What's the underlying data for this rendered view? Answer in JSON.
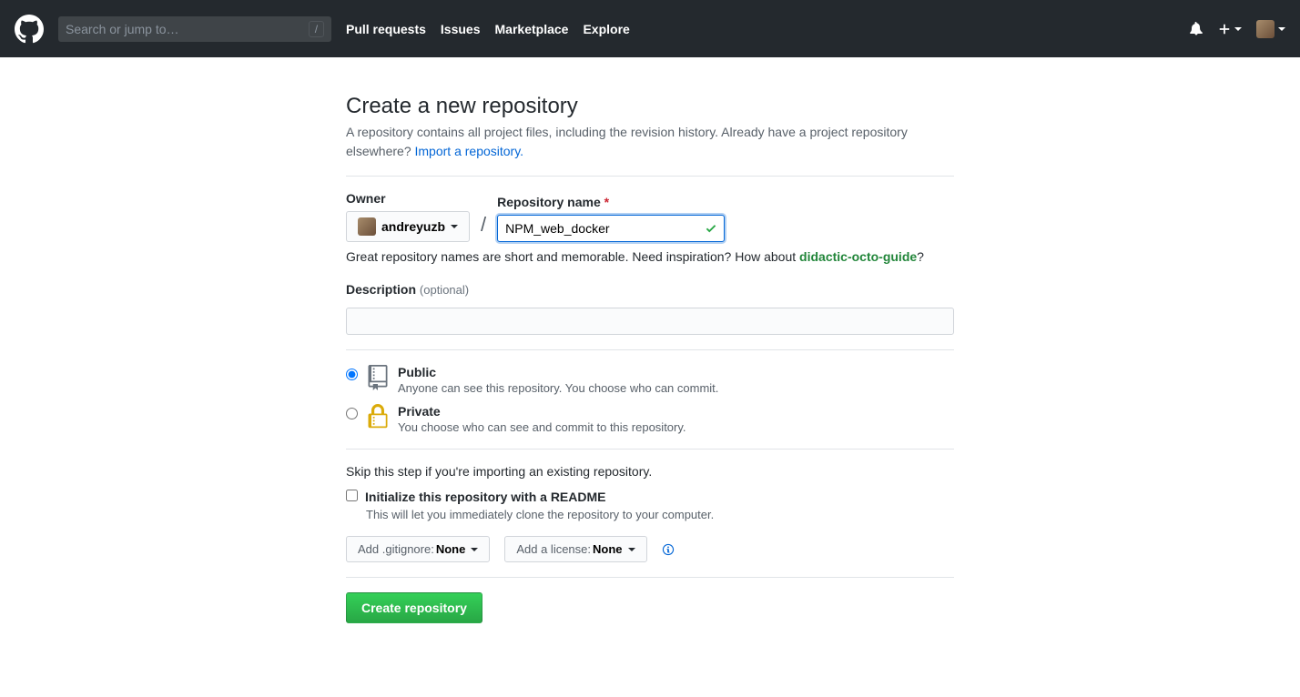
{
  "header": {
    "search_placeholder": "Search or jump to…",
    "nav": [
      "Pull requests",
      "Issues",
      "Marketplace",
      "Explore"
    ]
  },
  "page": {
    "title": "Create a new repository",
    "subhead_text": "A repository contains all project files, including the revision history. Already have a project repository elsewhere? ",
    "import_link": "Import a repository.",
    "owner_label": "Owner",
    "owner_name": "andreyuzb",
    "repo_label": "Repository name",
    "repo_value": "NPM_web_docker",
    "hint_prefix": "Great repository names are short and memorable. Need inspiration? How about ",
    "hint_suggestion": "didactic-octo-guide",
    "hint_suffix": "?",
    "desc_label": "Description",
    "desc_optional": "(optional)",
    "public": {
      "title": "Public",
      "desc": "Anyone can see this repository. You choose who can commit."
    },
    "private": {
      "title": "Private",
      "desc": "You choose who can see and commit to this repository."
    },
    "skip_note": "Skip this step if you're importing an existing repository.",
    "readme_title": "Initialize this repository with a README",
    "readme_desc": "This will let you immediately clone the repository to your computer.",
    "gitignore_label": "Add .gitignore: ",
    "gitignore_value": "None",
    "license_label": "Add a license: ",
    "license_value": "None",
    "submit": "Create repository"
  }
}
